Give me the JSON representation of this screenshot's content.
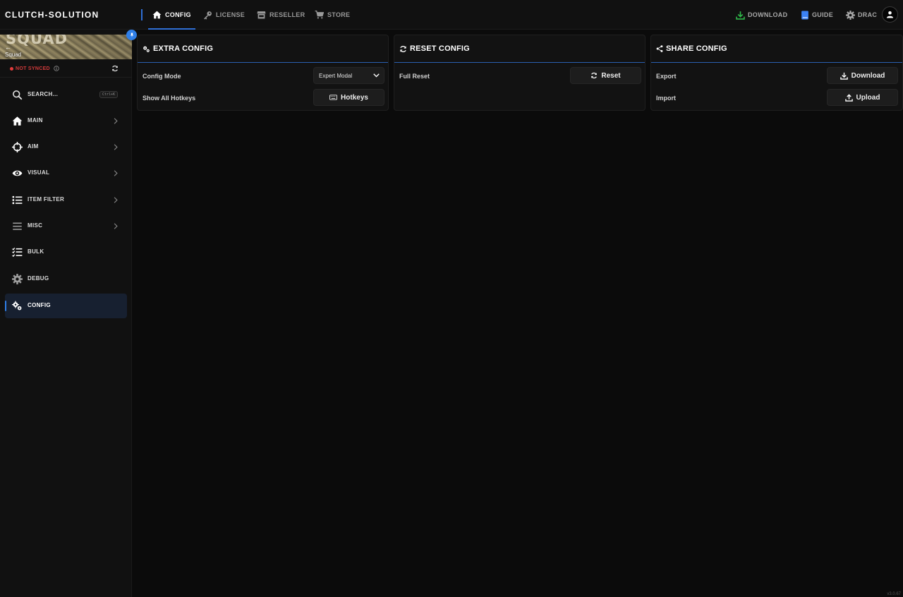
{
  "brand": "CLUTCH-SOLUTION",
  "nav": {
    "tabs": [
      {
        "label": "CONFIG",
        "icon": "home-icon"
      },
      {
        "label": "LICENSE",
        "icon": "key-icon"
      },
      {
        "label": "RESELLER",
        "icon": "store-icon"
      },
      {
        "label": "STORE",
        "icon": "cart-icon"
      }
    ],
    "active_tab": "CONFIG",
    "right": {
      "download": "DOWNLOAD",
      "guide": "GUIDE",
      "user": "DRAC"
    }
  },
  "sidebar": {
    "game": {
      "banner_text": "SQUAD",
      "name": "Squad"
    },
    "sync_status": "NOT SYNCED",
    "search": {
      "label": "SEARCH...",
      "shortcut": "Ctrl+K"
    },
    "items": [
      {
        "label": "MAIN",
        "icon": "home-icon",
        "has_chevron": true
      },
      {
        "label": "AIM",
        "icon": "crosshair-icon",
        "has_chevron": true
      },
      {
        "label": "VISUAL",
        "icon": "eye-icon",
        "has_chevron": true
      },
      {
        "label": "ITEM FILTER",
        "icon": "list-icon",
        "has_chevron": true
      },
      {
        "label": "MISC",
        "icon": "menu-icon",
        "has_chevron": true
      },
      {
        "label": "BULK",
        "icon": "checklist-icon",
        "has_chevron": false
      },
      {
        "label": "DEBUG",
        "icon": "gear-icon",
        "has_chevron": false
      },
      {
        "label": "CONFIG",
        "icon": "gears-icon",
        "has_chevron": false
      }
    ],
    "active_item": "CONFIG"
  },
  "panels": {
    "extra_config": {
      "title": "EXTRA CONFIG",
      "config_mode_label": "Config Mode",
      "config_mode_value": "Expert Modal",
      "hotkeys_label": "Show All Hotkeys",
      "hotkeys_button": "Hotkeys"
    },
    "reset_config": {
      "title": "RESET CONFIG",
      "full_reset_label": "Full Reset",
      "reset_button": "Reset"
    },
    "share_config": {
      "title": "SHARE CONFIG",
      "export_label": "Export",
      "download_button": "Download",
      "import_label": "Import",
      "upload_button": "Upload"
    }
  },
  "version": "v3.0.67",
  "colors": {
    "accent": "#2f7fe8",
    "background": "#0b0b0b",
    "panel": "#121212",
    "not_synced": "#e23b3b",
    "download_green": "#2fb84a",
    "guide_blue": "#3b82f6"
  }
}
